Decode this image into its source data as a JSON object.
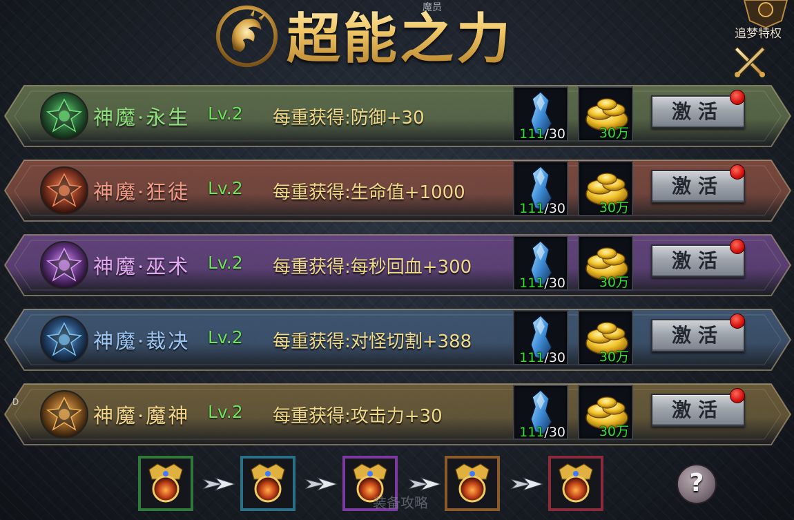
{
  "header": {
    "title": "超能之力",
    "top_small_text": "魔员",
    "top_right_label": "追梦特权",
    "close_icon": "crossed-swords-close-icon"
  },
  "rows": [
    {
      "name": "神魔·永生",
      "level": "Lv.2",
      "bonus": "每重获得:防御+30",
      "theme": "green",
      "name_color": "#8fe07e",
      "plate_color": "#5d6d4a",
      "material": {
        "icon": "blue-crystal-icon",
        "have": "111",
        "need": "/30"
      },
      "gold": {
        "icon": "gold-coins-icon",
        "amount": "30万"
      },
      "button": "激活"
    },
    {
      "name": "神魔·狂徒",
      "level": "Lv.2",
      "bonus": "每重获得:生命值+1000",
      "theme": "red",
      "name_color": "#f19a86",
      "plate_color": "#7d4a3e",
      "material": {
        "icon": "blue-crystal-icon",
        "have": "111",
        "need": "/30"
      },
      "gold": {
        "icon": "gold-coins-icon",
        "amount": "30万"
      },
      "button": "激活"
    },
    {
      "name": "神魔·巫术",
      "level": "Lv.2",
      "bonus": "每重获得:每秒回血+300",
      "theme": "purple",
      "name_color": "#e2a8f2",
      "plate_color": "#63447d",
      "material": {
        "icon": "blue-crystal-icon",
        "have": "111",
        "need": "/30"
      },
      "gold": {
        "icon": "gold-coins-icon",
        "amount": "30万"
      },
      "button": "激活"
    },
    {
      "name": "神魔·裁决",
      "level": "Lv.2",
      "bonus": "每重获得:对怪切割+388",
      "theme": "blue",
      "name_color": "#9ec6f4",
      "plate_color": "#3f5672",
      "material": {
        "icon": "blue-crystal-icon",
        "have": "111",
        "need": "/30"
      },
      "gold": {
        "icon": "gold-coins-icon",
        "amount": "30万"
      },
      "button": "激活"
    },
    {
      "name": "神魔·魔神",
      "level": "Lv.2",
      "bonus": "每重获得:攻击力+30",
      "theme": "gold",
      "name_color": "#f3d68c",
      "plate_color": "#6c5d3a",
      "material": {
        "icon": "blue-crystal-icon",
        "have": "111",
        "need": "/30"
      },
      "gold": {
        "icon": "gold-coins-icon",
        "amount": "30万"
      },
      "button": "激活"
    }
  ],
  "chain": [
    {
      "icon": "golden-amulet-icon",
      "frame_color": "#2f7a3a"
    },
    {
      "icon": "golden-amulet-icon",
      "frame_color": "#2b6f86"
    },
    {
      "icon": "golden-amulet-icon",
      "frame_color": "#7a3aa0"
    },
    {
      "icon": "golden-amulet-icon",
      "frame_color": "#8a5a2a"
    },
    {
      "icon": "golden-amulet-icon",
      "frame_color": "#8a2a3a"
    }
  ],
  "footer": {
    "help_label": "?",
    "faint_text": "装备攻略",
    "corner_letter": "D"
  }
}
